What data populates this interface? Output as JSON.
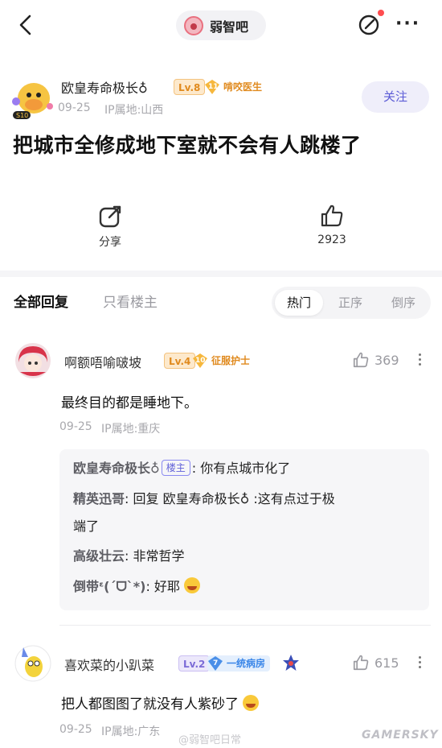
{
  "topbar": {
    "forum_name": "弱智吧"
  },
  "post": {
    "author": "欧皇寿命极长♁",
    "level": "Lv.8",
    "title_badge_num": "11",
    "title_badge": "啃咬医生",
    "date": "09-25",
    "ip": "IP属地:山西",
    "follow_label": "关注",
    "title": "把城市全修成地下室就不会有人跳楼了",
    "share_label": "分享",
    "likes": "2923"
  },
  "filters": {
    "all_replies": "全部回复",
    "op_only": "只看楼主",
    "sort": [
      "热门",
      "正序",
      "倒序"
    ]
  },
  "comments": [
    {
      "author": "啊额唔喻啵坡",
      "level": "Lv.4",
      "badge_num": "10",
      "badge": "征服护士",
      "likes": "369",
      "text": "最终目的都是睡地下。",
      "date": "09-25",
      "ip": "IP属地:重庆",
      "replies": [
        {
          "who": "欧皇寿命极长♁",
          "tag": "楼主",
          "text": ": 你有点城市化了"
        },
        {
          "who": "精英迅哥",
          "text": ": 回复 欧皇寿命极长♁ :这有点过于极",
          "cont": "端了"
        },
        {
          "who": "高级壮云",
          "text": ": 非常哲学"
        },
        {
          "who": "倒带ᵋ(ˊᗜˋ*)",
          "text": ": 好耶"
        }
      ]
    },
    {
      "author": "喜欢菜的小趴菜",
      "level": "Lv.2",
      "badge_num": "7",
      "badge": "一统病房",
      "likes": "615",
      "text": "把人都图图了就没有人紫砂了",
      "date": "09-25",
      "ip": "IP属地:广东"
    }
  ],
  "watermark": "@弱智吧日常",
  "watermark2": "GAMERSKY"
}
